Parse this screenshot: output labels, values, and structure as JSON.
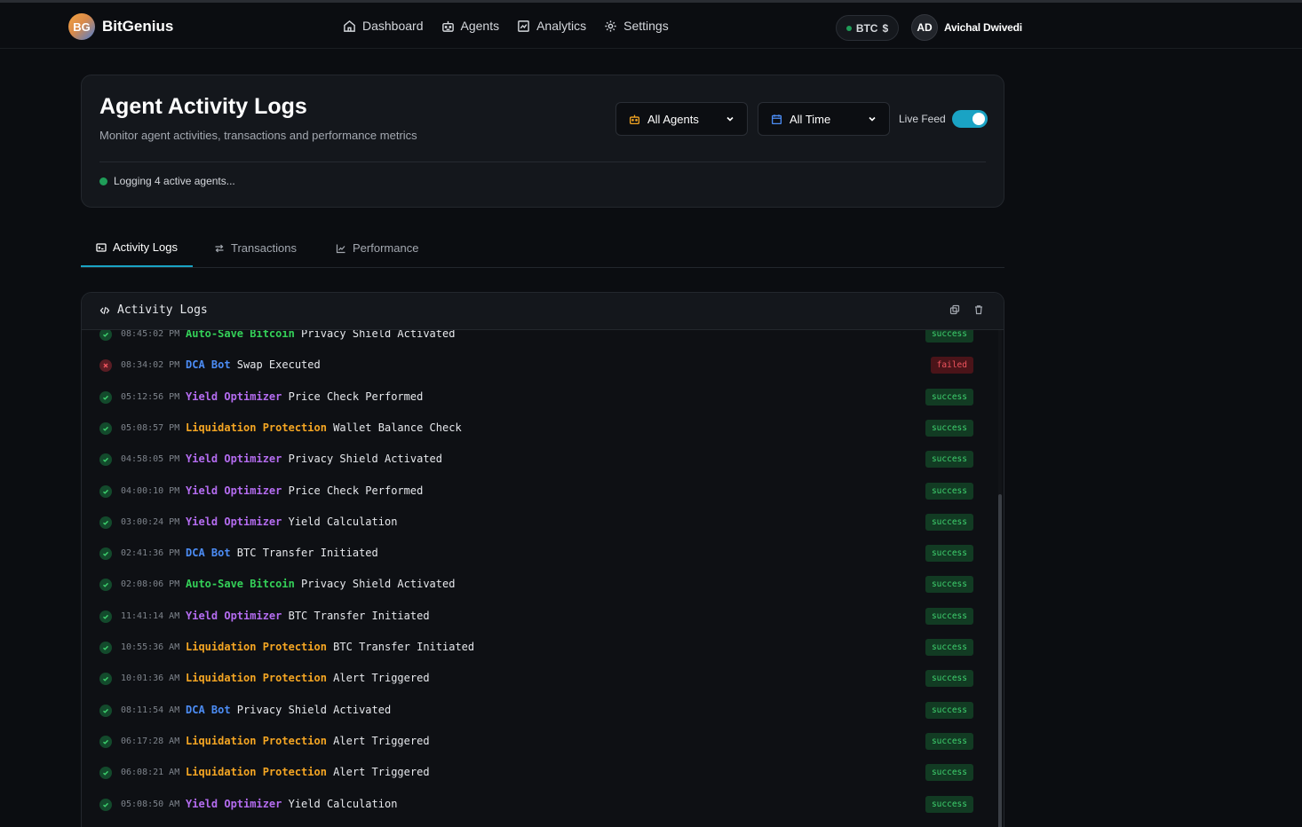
{
  "app": {
    "logo_initials": "BG",
    "name": "BitGenius"
  },
  "nav": [
    {
      "label": "Dashboard",
      "icon": "home-icon"
    },
    {
      "label": "Agents",
      "icon": "robot-icon"
    },
    {
      "label": "Analytics",
      "icon": "chart-icon"
    },
    {
      "label": "Settings",
      "icon": "gear-icon"
    }
  ],
  "wallet": {
    "label": "BTC",
    "symbol": "$"
  },
  "user": {
    "initials": "AD",
    "name": "Avichal Dwivedi"
  },
  "header": {
    "title": "Agent Activity Logs",
    "subtitle": "Monitor agent activities, transactions and performance metrics",
    "agent_filter": "All Agents",
    "time_filter": "All Time",
    "live_feed_label": "Live Feed",
    "live_feed_on": true,
    "status_text": "Logging 4 active agents..."
  },
  "tabs": [
    "Activity Logs",
    "Transactions",
    "Performance"
  ],
  "log_panel": {
    "title": "Activity Logs"
  },
  "colors": {
    "accent": "#1aa3c4",
    "success": "#3ed16e",
    "failed": "#f0545e",
    "agent_auto_save": "#34d058",
    "agent_dca": "#4c8df6",
    "agent_yield": "#b46cf0",
    "agent_liquidation": "#f5a623"
  },
  "logs": [
    {
      "time": "08:45:02",
      "ampm": "PM",
      "agent": "Auto-Save Bitcoin",
      "color": "green",
      "action": "Privacy Shield Activated",
      "status": "success"
    },
    {
      "time": "08:34:02",
      "ampm": "PM",
      "agent": "DCA Bot",
      "color": "blue",
      "action": "Swap Executed",
      "status": "failed"
    },
    {
      "time": "05:12:56",
      "ampm": "PM",
      "agent": "Yield Optimizer",
      "color": "purple",
      "action": "Price Check Performed",
      "status": "success"
    },
    {
      "time": "05:08:57",
      "ampm": "PM",
      "agent": "Liquidation Protection",
      "color": "orange",
      "action": "Wallet Balance Check",
      "status": "success"
    },
    {
      "time": "04:58:05",
      "ampm": "PM",
      "agent": "Yield Optimizer",
      "color": "purple",
      "action": "Privacy Shield Activated",
      "status": "success"
    },
    {
      "time": "04:00:10",
      "ampm": "PM",
      "agent": "Yield Optimizer",
      "color": "purple",
      "action": "Price Check Performed",
      "status": "success"
    },
    {
      "time": "03:00:24",
      "ampm": "PM",
      "agent": "Yield Optimizer",
      "color": "purple",
      "action": "Yield Calculation",
      "status": "success"
    },
    {
      "time": "02:41:36",
      "ampm": "PM",
      "agent": "DCA Bot",
      "color": "blue",
      "action": "BTC Transfer Initiated",
      "status": "success"
    },
    {
      "time": "02:08:06",
      "ampm": "PM",
      "agent": "Auto-Save Bitcoin",
      "color": "green",
      "action": "Privacy Shield Activated",
      "status": "success"
    },
    {
      "time": "11:41:14",
      "ampm": "AM",
      "agent": "Yield Optimizer",
      "color": "purple",
      "action": "BTC Transfer Initiated",
      "status": "success"
    },
    {
      "time": "10:55:36",
      "ampm": "AM",
      "agent": "Liquidation Protection",
      "color": "orange",
      "action": "BTC Transfer Initiated",
      "status": "success"
    },
    {
      "time": "10:01:36",
      "ampm": "AM",
      "agent": "Liquidation Protection",
      "color": "orange",
      "action": "Alert Triggered",
      "status": "success"
    },
    {
      "time": "08:11:54",
      "ampm": "AM",
      "agent": "DCA Bot",
      "color": "blue",
      "action": "Privacy Shield Activated",
      "status": "success"
    },
    {
      "time": "06:17:28",
      "ampm": "AM",
      "agent": "Liquidation Protection",
      "color": "orange",
      "action": "Alert Triggered",
      "status": "success"
    },
    {
      "time": "06:08:21",
      "ampm": "AM",
      "agent": "Liquidation Protection",
      "color": "orange",
      "action": "Alert Triggered",
      "status": "success"
    },
    {
      "time": "05:08:50",
      "ampm": "AM",
      "agent": "Yield Optimizer",
      "color": "purple",
      "action": "Yield Calculation",
      "status": "success"
    }
  ]
}
